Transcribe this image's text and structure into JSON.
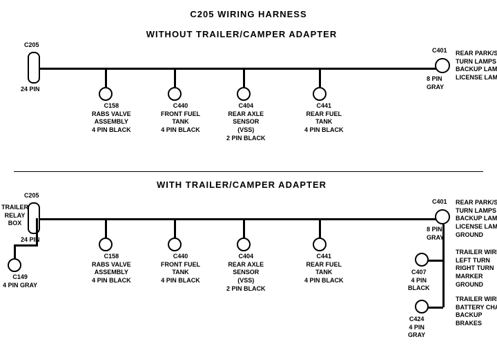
{
  "title": "C205 WIRING HARNESS",
  "section1": {
    "label": "WITHOUT  TRAILER/CAMPER  ADAPTER",
    "connectors": [
      {
        "id": "C205_top",
        "label": "C205",
        "sublabel": "24 PIN"
      },
      {
        "id": "C401_top",
        "label": "C401",
        "sublabel": "8 PIN\nGRAY"
      },
      {
        "id": "C158_top",
        "label": "C158",
        "sublabel": "RABS VALVE\nASSEMBLY\n4 PIN BLACK"
      },
      {
        "id": "C440_top",
        "label": "C440",
        "sublabel": "FRONT FUEL\nTANK\n4 PIN BLACK"
      },
      {
        "id": "C404_top",
        "label": "C404",
        "sublabel": "REAR AXLE\nSENSOR\n(VSS)\n2 PIN BLACK"
      },
      {
        "id": "C441_top",
        "label": "C441",
        "sublabel": "REAR FUEL\nTANK\n4 PIN BLACK"
      }
    ],
    "right_label": "REAR PARK/STOP\nTURN LAMPS\nBACKUP LAMPS\nLICENSE LAMPS"
  },
  "section2": {
    "label": "WITH  TRAILER/CAMPER  ADAPTER",
    "connectors": [
      {
        "id": "C205_bot",
        "label": "C205",
        "sublabel": "24 PIN"
      },
      {
        "id": "C401_bot",
        "label": "C401",
        "sublabel": "8 PIN\nGRAY"
      },
      {
        "id": "C158_bot",
        "label": "C158",
        "sublabel": "RABS VALVE\nASSEMBLY\n4 PIN BLACK"
      },
      {
        "id": "C440_bot",
        "label": "C440",
        "sublabel": "FRONT FUEL\nTANK\n4 PIN BLACK"
      },
      {
        "id": "C404_bot",
        "label": "C404",
        "sublabel": "REAR AXLE\nSENSOR\n(VSS)\n2 PIN BLACK"
      },
      {
        "id": "C441_bot",
        "label": "C441",
        "sublabel": "REAR FUEL\nTANK\n4 PIN BLACK"
      },
      {
        "id": "C149",
        "label": "C149",
        "sublabel": "4 PIN GRAY"
      },
      {
        "id": "C407",
        "label": "C407",
        "sublabel": "4 PIN\nBLACK"
      },
      {
        "id": "C424",
        "label": "C424",
        "sublabel": "4 PIN\nGRAY"
      }
    ],
    "trailer_relay": "TRAILER\nRELAY\nBOX",
    "right_labels": {
      "c401": "REAR PARK/STOP\nTURN LAMPS\nBACKUP LAMPS\nLICENSE LAMPS\nGROUND",
      "c407": "TRAILER WIRES\nLEFT TURN\nRIGHT TURN\nMARKER\nGROUND",
      "c424": "TRAILER WIRES\nBATTERY CHARGE\nBACKUP\nBRAKES"
    }
  }
}
